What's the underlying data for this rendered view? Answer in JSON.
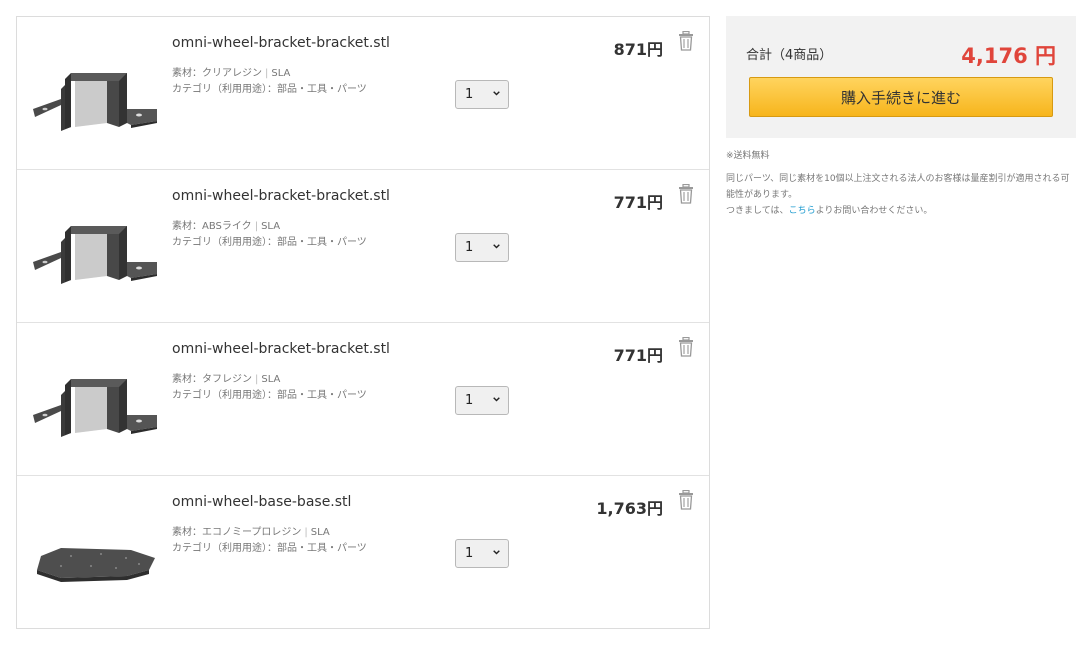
{
  "cart": {
    "items": [
      {
        "name": "omni-wheel-bracket-bracket.stl",
        "material": "素材：クリアレジン",
        "method": "SLA",
        "category": "カテゴリ（利用用途）：部品・工具・パーツ",
        "qty": "1",
        "price": "871円",
        "thumbnail": "bracket"
      },
      {
        "name": "omni-wheel-bracket-bracket.stl",
        "material": "素材：ABSライク",
        "method": "SLA",
        "category": "カテゴリ（利用用途）：部品・工具・パーツ",
        "qty": "1",
        "price": "771円",
        "thumbnail": "bracket"
      },
      {
        "name": "omni-wheel-bracket-bracket.stl",
        "material": "素材：タフレジン",
        "method": "SLA",
        "category": "カテゴリ（利用用途）：部品・工具・パーツ",
        "qty": "1",
        "price": "771円",
        "thumbnail": "bracket"
      },
      {
        "name": "omni-wheel-base-base.stl",
        "material": "素材：エコノミープロレジン",
        "method": "SLA",
        "category": "カテゴリ（利用用途）：部品・工具・パーツ",
        "qty": "1",
        "price": "1,763円",
        "thumbnail": "base-plate"
      }
    ],
    "separator": "|",
    "delete_icon": "trash-icon",
    "select_icon": "chevron-down-icon"
  },
  "summary": {
    "label": "合計（4商品）",
    "amount": "4,176 円",
    "checkout_label": "購入手続きに進む",
    "amount_color": "#e0453b",
    "button_color": "#f9c12e"
  },
  "notes": {
    "shipping": "※送料無料",
    "bulk_line1": "同じパーツ、同じ素材を10個以上注文される法人のお客様は量産割引が適用される可能性があります。",
    "bulk_line2_prefix": "つきましては、",
    "bulk_link": "こちら",
    "bulk_line2_suffix": "よりお問い合わせください。",
    "link_color": "#1f9bcf"
  }
}
